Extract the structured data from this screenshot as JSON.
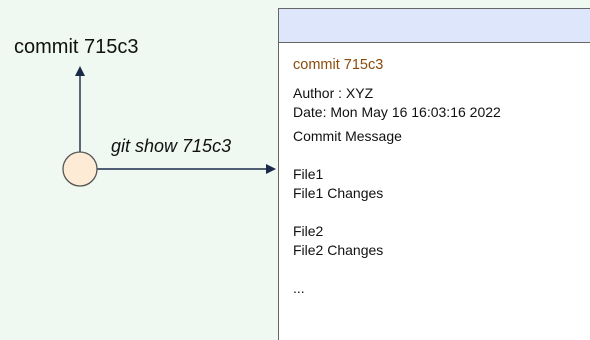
{
  "diagram": {
    "node_label": "commit 715c3",
    "edge_label": "git show 715c3",
    "colors": {
      "background": "#eff8f1",
      "node_fill": "#fdebd6",
      "arrow": "#1b2a4a",
      "panel_header": "#dde6fb",
      "commit_text": "#8a4b0b"
    }
  },
  "panel": {
    "commit_line": "commit 715c3",
    "author_line": "Author : XYZ",
    "date_line": "Date: Mon May 16 16:03:16 2022",
    "message_line": "Commit Message",
    "file1_name": "File1",
    "file1_changes": "File1 Changes",
    "file2_name": "File2",
    "file2_changes": "File2 Changes",
    "ellipsis": "..."
  }
}
